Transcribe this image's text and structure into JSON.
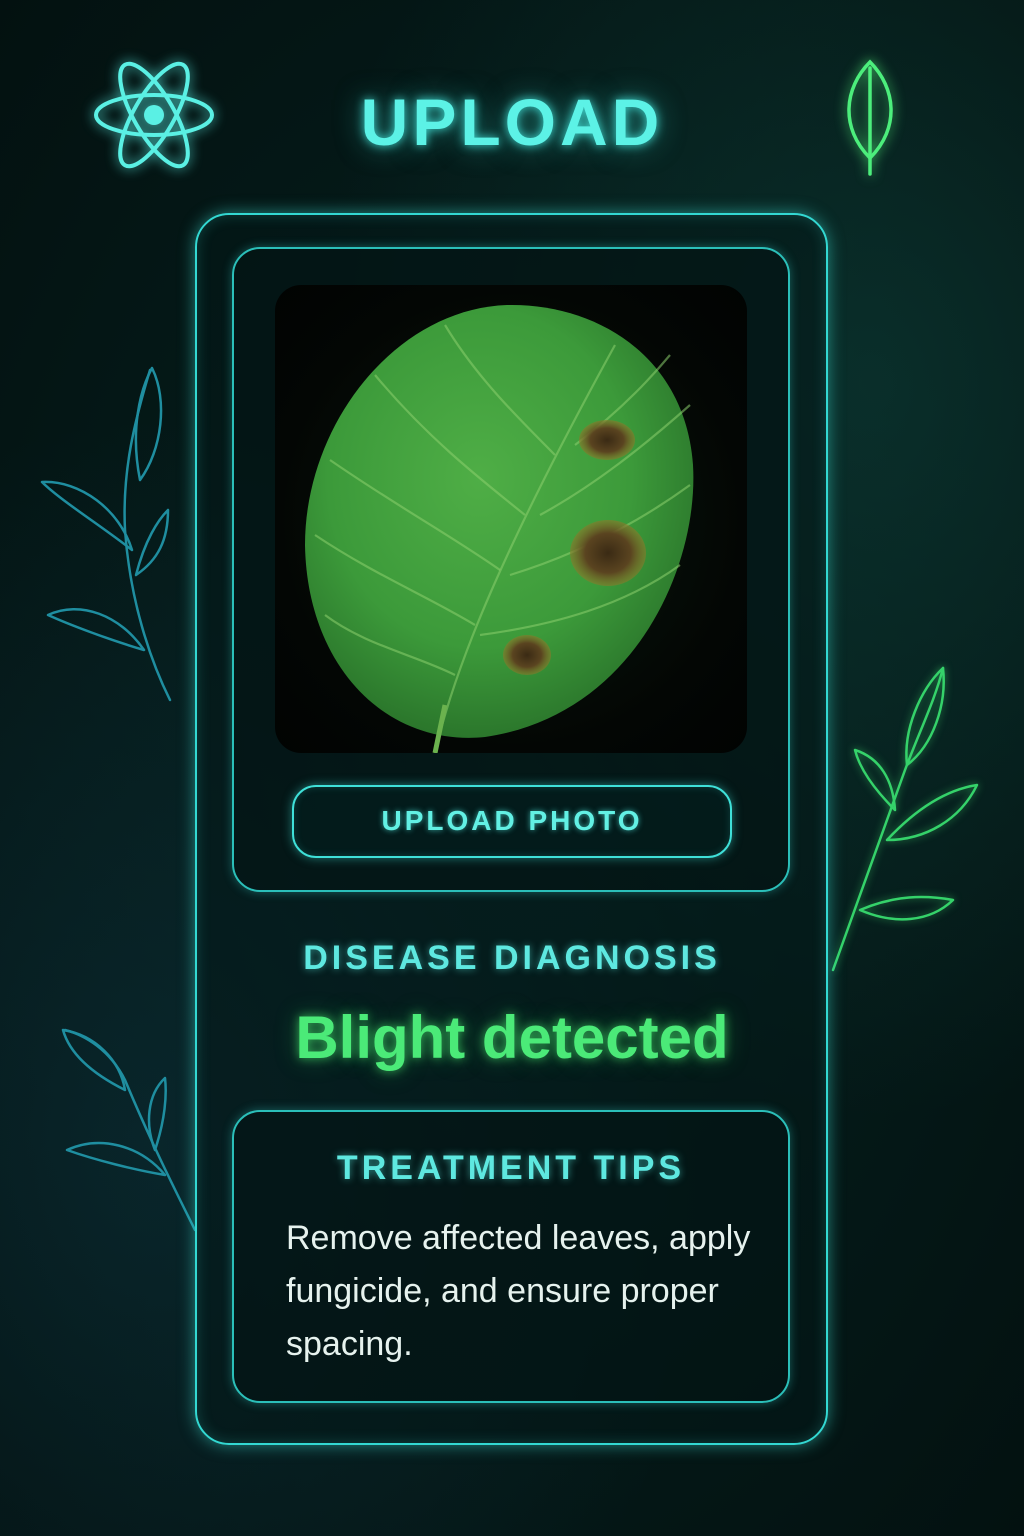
{
  "header": {
    "title": "UPLOAD",
    "left_icon": "atom-icon",
    "right_icon": "leaf-icon"
  },
  "upload": {
    "image_subject": "leaf with brown spots",
    "button_label": "UPLOAD PHOTO"
  },
  "diagnosis": {
    "label": "DISEASE DIAGNOSIS",
    "result": "Blight detected"
  },
  "treatment": {
    "title": "TREATMENT TIPS",
    "text": "Remove affected leaves, apply fungicide, and ensure proper spacing."
  },
  "colors": {
    "accent_cyan": "#5cf2e6",
    "accent_green": "#4bea78",
    "background": "#041615"
  }
}
